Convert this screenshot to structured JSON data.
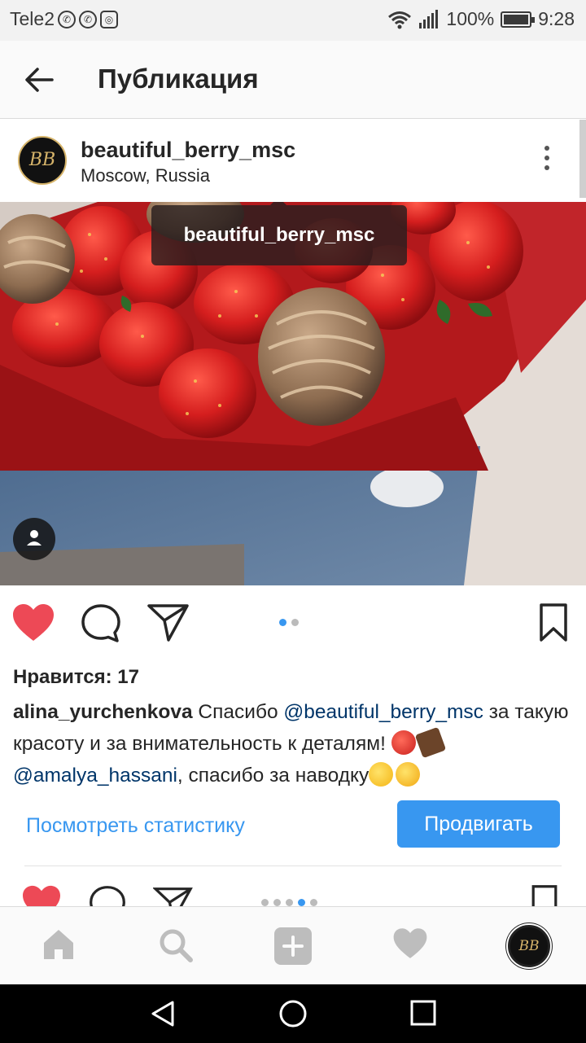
{
  "status_bar": {
    "carrier": "Tele2",
    "battery": "100%",
    "time": "9:28"
  },
  "appbar": {
    "title": "Публикация"
  },
  "post": {
    "username": "beautiful_berry_msc",
    "location": "Moscow, Russia",
    "avatar_text": "BB",
    "photo_tag": "beautiful_berry_msc",
    "likes": "Нравится: 17",
    "carousel": {
      "count": 2,
      "active_index": 0
    },
    "caption": {
      "author": "alina_yurchenkova",
      "text_1": " Спасибо ",
      "mention_1": "@beautiful_berry_msc",
      "text_2": " за такую красоту и за внимательность к деталям! ",
      "emoji_1": "strawberry",
      "emoji_2": "chocolate",
      "mention_2": "@amalya_hassani",
      "text_3": ", спасибо за наводку",
      "emoji_3": "winking-face",
      "emoji_4": "kissing-cat"
    },
    "stats_link": "Посмотреть статистику",
    "promote_button": "Продвигать"
  },
  "next_post": {
    "carousel": {
      "count": 5,
      "active_index": 3
    }
  },
  "tabs": [
    "home-icon",
    "search-icon",
    "add-icon",
    "activity-heart-icon",
    "profile-avatar"
  ],
  "colors": {
    "accent": "#3897f0",
    "like": "#ed4956",
    "text": "#262626",
    "mention": "#003569"
  }
}
